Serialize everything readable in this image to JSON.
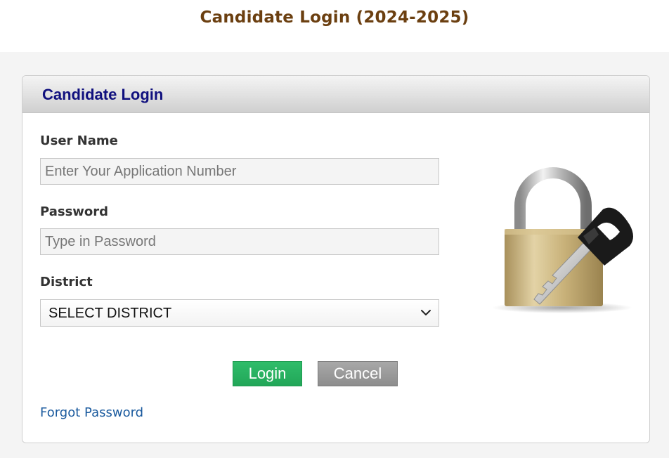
{
  "header": {
    "title": "Candidate Login (2024-2025)"
  },
  "panel": {
    "title": "Candidate Login",
    "username": {
      "label": "User Name",
      "placeholder": "Enter Your Application Number",
      "value": ""
    },
    "password": {
      "label": "Password",
      "placeholder": "Type in Password",
      "value": ""
    },
    "district": {
      "label": "District",
      "selected": "SELECT DISTRICT"
    },
    "buttons": {
      "login": "Login",
      "cancel": "Cancel"
    },
    "forgot_password": "Forgot Password",
    "illustration": "padlock-with-key-icon"
  },
  "colors": {
    "title": "#6b3f10",
    "panel_title": "#10107e",
    "login_button": "#2bb362",
    "cancel_button": "#999999",
    "link": "#1a5a9e"
  }
}
